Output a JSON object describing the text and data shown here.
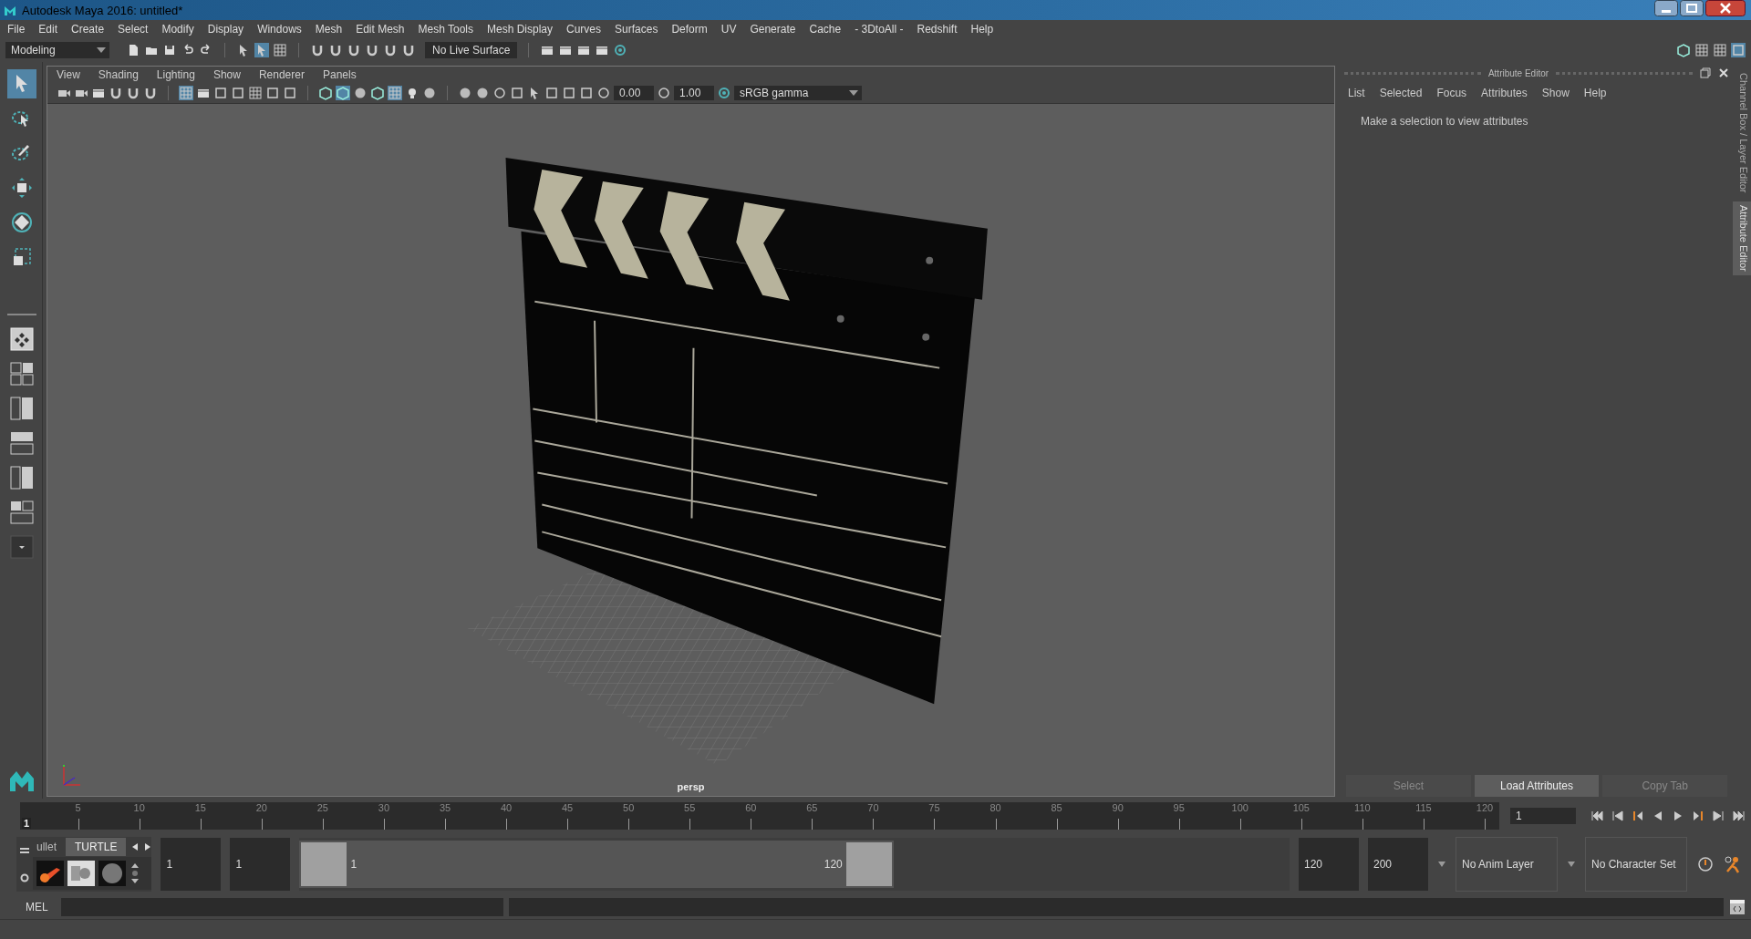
{
  "window": {
    "title": "Autodesk Maya 2016: untitled*"
  },
  "menu_bar": [
    "File",
    "Edit",
    "Create",
    "Select",
    "Modify",
    "Display",
    "Windows",
    "Mesh",
    "Edit Mesh",
    "Mesh Tools",
    "Mesh Display",
    "Curves",
    "Surfaces",
    "Deform",
    "UV",
    "Generate",
    "Cache",
    "- 3DtoAll -",
    "Redshift",
    "Help"
  ],
  "status_line": {
    "mode": "Modeling",
    "live_surface": "No Live Surface"
  },
  "toolbox": {
    "tools": [
      {
        "kind": "select",
        "selected": true
      },
      {
        "kind": "lasso",
        "selected": false
      },
      {
        "kind": "paint",
        "selected": false
      },
      {
        "kind": "move",
        "selected": false
      },
      {
        "kind": "rotate",
        "selected": false
      },
      {
        "kind": "scale",
        "selected": false
      }
    ]
  },
  "viewport": {
    "menus": [
      "View",
      "Shading",
      "Lighting",
      "Show",
      "Renderer",
      "Panels"
    ],
    "exposure": "0.00",
    "gamma": "1.00",
    "color_space": "sRGB gamma",
    "camera": "persp",
    "kind": "picture"
  },
  "attribute_editor": {
    "title": "Attribute Editor",
    "menus": [
      "List",
      "Selected",
      "Focus",
      "Attributes",
      "Show",
      "Help"
    ],
    "message": "Make a selection to view attributes",
    "buttons": [
      {
        "label": "Select",
        "disabled": true
      },
      {
        "label": "Load Attributes",
        "disabled": false
      },
      {
        "label": "Copy Tab",
        "disabled": true
      }
    ]
  },
  "side_tabs": [
    {
      "label": "Channel Box / Layer Editor",
      "selected": false
    },
    {
      "label": "Attribute Editor",
      "selected": true
    }
  ],
  "time_slider": {
    "current_marker": "1",
    "ticks": [
      "5",
      "10",
      "15",
      "20",
      "25",
      "30",
      "35",
      "40",
      "45",
      "50",
      "55",
      "60",
      "65",
      "70",
      "75",
      "80",
      "85",
      "90",
      "95",
      "100",
      "105",
      "110",
      "115",
      "120"
    ],
    "current_frame": "1"
  },
  "shelf": {
    "tabs": [
      {
        "label": "ullet",
        "selected": false
      },
      {
        "label": "TURTLE",
        "selected": true
      }
    ]
  },
  "range": {
    "start": "1",
    "playback_start": "1",
    "range_start": "1",
    "range_end": "120",
    "playback_end": "120",
    "end": "200"
  },
  "anim_layer": "No Anim Layer",
  "character_set": "No Character Set",
  "command_line": {
    "language": "MEL"
  }
}
